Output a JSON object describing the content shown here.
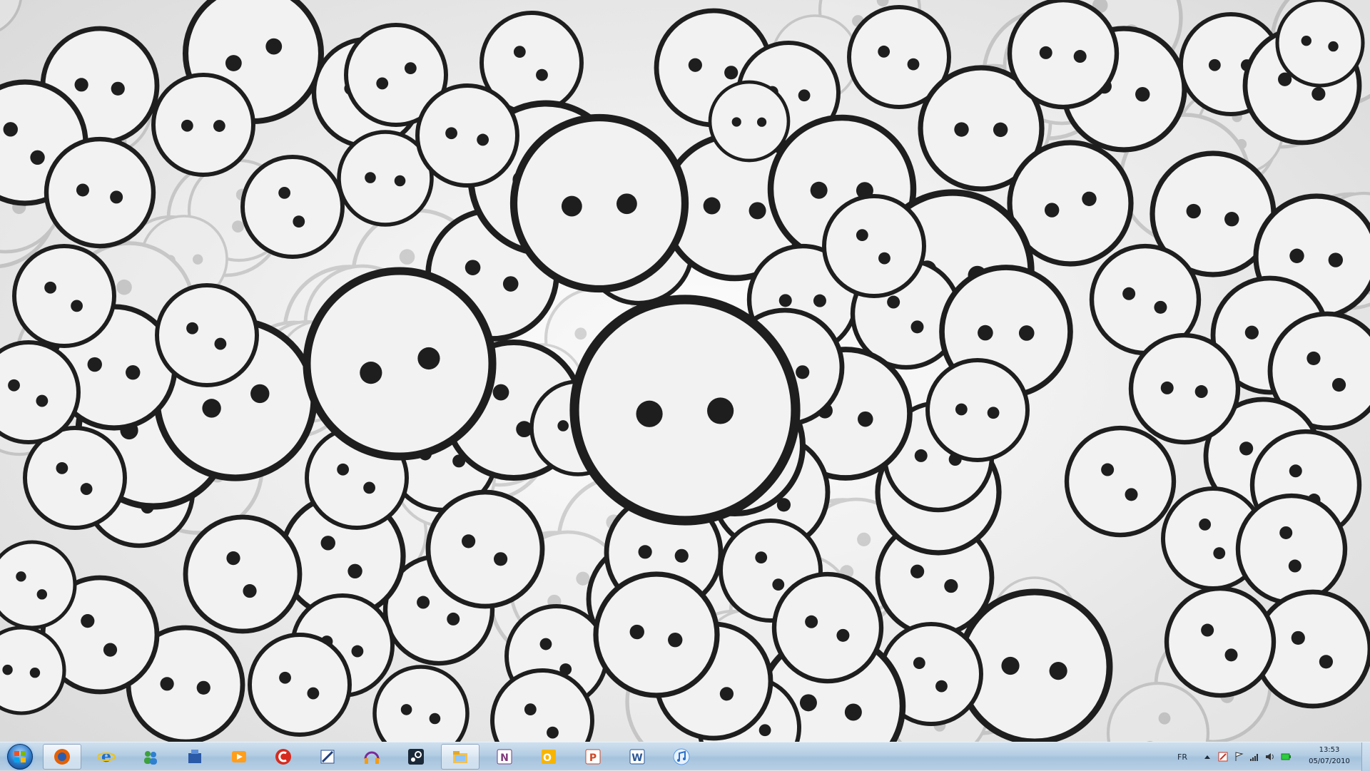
{
  "wallpaper": {
    "description_icon": "smiley-faces-wallpaper",
    "colors": {
      "face_fill": "#f2f2f2",
      "outline": "#1e1e1e",
      "faded_outline": "#8a8a8a"
    }
  },
  "taskbar": {
    "start_icon": "windows-start-orb",
    "pinned": [
      {
        "name": "firefox-icon",
        "active": true
      },
      {
        "name": "internet-explorer-icon",
        "active": false
      },
      {
        "name": "windows-live-messenger-icon",
        "active": false
      },
      {
        "name": "network-app-icon",
        "active": false
      },
      {
        "name": "media-player-icon",
        "active": false
      },
      {
        "name": "ccleaner-icon",
        "active": false
      },
      {
        "name": "paint-edit-icon",
        "active": false
      },
      {
        "name": "audio-headphones-icon",
        "active": false
      },
      {
        "name": "steam-icon",
        "active": false
      },
      {
        "name": "windows-explorer-icon",
        "active": true
      },
      {
        "name": "onenote-icon",
        "active": false
      },
      {
        "name": "outlook-icon",
        "active": false
      },
      {
        "name": "powerpoint-icon",
        "active": false
      },
      {
        "name": "word-icon",
        "active": false
      },
      {
        "name": "itunes-icon",
        "active": false
      }
    ],
    "tray": {
      "language": "FR",
      "icons": [
        "show-hidden-icons-arrow-icon",
        "antivirus-icon",
        "action-center-flag-icon",
        "network-signal-icon",
        "volume-icon",
        "battery-icon"
      ],
      "time": "13:53",
      "date": "05/07/2010"
    }
  }
}
